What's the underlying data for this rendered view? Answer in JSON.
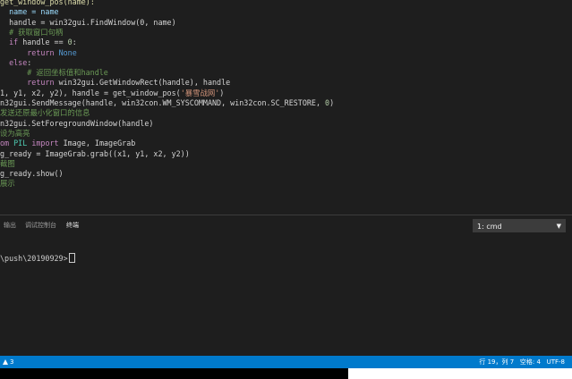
{
  "editor": {
    "lines": [
      [
        {
          "t": "get_window_pos(name):",
          "c": "fn"
        }
      ],
      [
        {
          "t": "  name = name",
          "c": "var"
        }
      ],
      [
        {
          "t": "  handle = win32gui.FindWindow(0, name)",
          "c": ""
        }
      ],
      [
        {
          "t": "  # 获取窗口句柄",
          "c": "cmt"
        }
      ],
      [
        {
          "t": "  ",
          "c": ""
        },
        {
          "t": "if",
          "c": "kw"
        },
        {
          "t": " handle == ",
          "c": ""
        },
        {
          "t": "0",
          "c": "num"
        },
        {
          "t": ":",
          "c": ""
        }
      ],
      [
        {
          "t": "      ",
          "c": ""
        },
        {
          "t": "return",
          "c": "kw"
        },
        {
          "t": " ",
          "c": ""
        },
        {
          "t": "None",
          "c": "blue"
        }
      ],
      [
        {
          "t": "  ",
          "c": ""
        },
        {
          "t": "else",
          "c": "kw"
        },
        {
          "t": ":",
          "c": ""
        }
      ],
      [
        {
          "t": "      # 返回坐标值和handle",
          "c": "cmt"
        }
      ],
      [
        {
          "t": "      ",
          "c": ""
        },
        {
          "t": "return",
          "c": "kw"
        },
        {
          "t": " win32gui.GetWindowRect(handle), handle",
          "c": ""
        }
      ],
      [
        {
          "t": "1, y1, x2, y2), handle = get_window_pos(",
          "c": ""
        },
        {
          "t": "'暴雪战网'",
          "c": "str"
        },
        {
          "t": ")",
          "c": ""
        }
      ],
      [
        {
          "t": "n32gui.SendMessage(handle, win32con.WM_SYSCOMMAND, win32con.SC_RESTORE, ",
          "c": ""
        },
        {
          "t": "0",
          "c": "num"
        },
        {
          "t": ")",
          "c": ""
        }
      ],
      [
        {
          "t": "发送还原最小化窗口的信息",
          "c": "cmt"
        }
      ],
      [
        {
          "t": "n32gui.SetForegroundWindow(handle)",
          "c": ""
        }
      ],
      [
        {
          "t": "设为高亮",
          "c": "cmt"
        }
      ],
      [
        {
          "t": "om",
          "c": "kw"
        },
        {
          "t": " PIL ",
          "c": "cls"
        },
        {
          "t": "import",
          "c": "kw"
        },
        {
          "t": " Image, ImageGrab",
          "c": ""
        }
      ],
      [
        {
          "t": "g_ready = ImageGrab.grab((x1, y1, x2, y2))",
          "c": ""
        }
      ],
      [
        {
          "t": "截图",
          "c": "cmt"
        }
      ],
      [
        {
          "t": "g_ready.show()",
          "c": ""
        }
      ],
      [
        {
          "t": "展示",
          "c": "cmt"
        }
      ]
    ]
  },
  "panel": {
    "tabs": [
      {
        "label": "输出",
        "active": false
      },
      {
        "label": "调试控制台",
        "active": false
      },
      {
        "label": "终端",
        "active": true
      }
    ],
    "terminal_select": "1: cmd",
    "terminal_prompt": "\\push\\20190929>"
  },
  "status": {
    "warnings": "3",
    "line_col": "行 19，列 7",
    "spaces": "空格: 4",
    "encoding": "UTF-8"
  }
}
